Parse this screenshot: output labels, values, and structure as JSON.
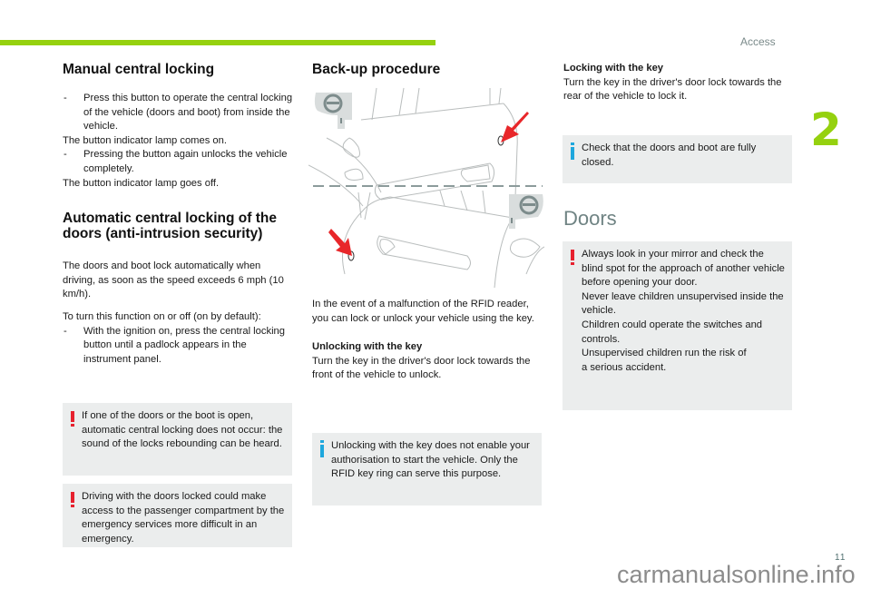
{
  "header": {
    "section_label": "Access",
    "chapter_number": "2",
    "accent_color": "#95d10f"
  },
  "footer": {
    "page_number": "11",
    "watermark": "carmanualsonline.info"
  },
  "col1": {
    "manual_title": "Manual central locking",
    "manual_items": [
      {
        "type": "dash",
        "text": "Press this button to operate the central locking of the vehicle (doors and boot) from inside the vehicle."
      },
      {
        "type": "plain",
        "text": "The button indicator lamp comes on."
      },
      {
        "type": "dash",
        "text": "Pressing the button again unlocks the vehicle completely."
      },
      {
        "type": "plain",
        "text": "The button indicator lamp goes off."
      }
    ],
    "auto_title": "Automatic central locking of the doors (anti-intrusion security)",
    "auto_para": "The doors and boot lock automatically when driving, as soon as the speed exceeds 6 mph (10 km/h).",
    "toggle_intro": "To turn this function on or off (on by default):",
    "toggle_dash": "With the ignition on, press the central locking button until a padlock appears in the instrument panel.",
    "warning1": "If one of the doors or the boot is open, automatic central locking does not occur: the sound of the locks rebounding can be heard.",
    "warning2": "Driving with the doors locked could make access to the passenger compartment by the emergency services more difficult in an emergency."
  },
  "col2": {
    "title": "Back-up procedure",
    "illustration": "driver door lock diagram (front and rear door key cylinders with red arrows)",
    "para": "In the event of a malfunction of the RFID reader, you can lock or unlock your vehicle using the key.",
    "unlock_title": "Unlocking with the key",
    "unlock_text": "Turn the key in the driver's door lock towards the front of the vehicle to unlock.",
    "info": "Unlocking with the key does not enable your authorisation to start the vehicle. Only the RFID key ring can serve this purpose."
  },
  "col3": {
    "lock_title": "Locking with the key",
    "lock_text": "Turn the key in the driver's door lock towards the rear of the vehicle to lock it.",
    "info": "Check that the doors and boot are fully closed.",
    "doors_title": "Doors",
    "warning_lines": [
      "Always look in your mirror and check the blind spot for the approach of another vehicle before opening your door.",
      "Never leave children unsupervised inside the vehicle.",
      "Children could operate the switches and controls.",
      "Unsupervised children run the risk of a serious accident."
    ]
  }
}
